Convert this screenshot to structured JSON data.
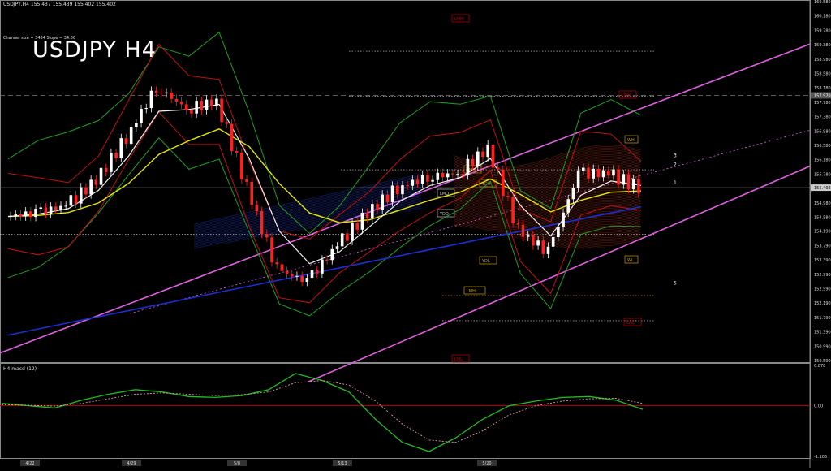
{
  "header": {
    "ohlc": "USDJPY,H4  155.437 155.439 155.402 155.402",
    "channel_info": "Channel size = 3484 Slope = 34.06",
    "title": "USDJPY H4",
    "macd_label": "H4  macd (12)"
  },
  "colors": {
    "background": "#000000",
    "bull_candle": "#ffffff",
    "bear_candle": "#ff2020",
    "channel": "#e060e0",
    "ema_slow": "#1a2fd6",
    "ema_mid": "#e6e600",
    "ema_fast": "#f0f0f0",
    "green_band": "#1fa01f",
    "red_band": "#c01010",
    "macd_main": "#20c020",
    "macd_signal": "#e0a0a0",
    "macd_zero": "#c00000"
  },
  "chart_data": [
    {
      "type": "line",
      "title": "USDJPY H4",
      "series": [
        {
          "name": "",
          "x": [
            "4/22",
            "4/23",
            "4/24",
            "4/25",
            "4/26",
            "4/29",
            "4/30",
            "5/1",
            "5/2",
            "5/3",
            "5/6",
            "5/7",
            "5/8",
            "5/9",
            "5/10",
            "5/13",
            "5/14",
            "5/15",
            "5/16",
            "5/17",
            "5/20",
            "5/21"
          ],
          "values": [
            154.6,
            154.7,
            154.9,
            155.6,
            156.8,
            158.2,
            157.6,
            157.8,
            155.4,
            153.1,
            152.8,
            153.8,
            154.7,
            155.4,
            155.7,
            155.8,
            156.5,
            154.2,
            153.6,
            155.8,
            155.8,
            155.4
          ]
        }
      ],
      "y_ticks": [
        "160.580",
        "160.180",
        "159.780",
        "159.380",
        "158.980",
        "158.580",
        "158.180",
        "157.780",
        "157.380",
        "156.980",
        "156.580",
        "156.180",
        "155.780",
        "155.402",
        "154.980",
        "154.580",
        "154.190",
        "153.790",
        "153.390",
        "152.990",
        "152.590",
        "152.190",
        "151.790",
        "151.390",
        "150.990",
        "150.590"
      ],
      "price_label": "155.402",
      "dashed_level_label": "157.970",
      "x_ticks": [
        "4/22",
        "4/29",
        "5/8",
        "5/13",
        "5/20"
      ],
      "ylim": [
        150.59,
        160.58
      ],
      "levels": [
        "LMH",
        "LWH",
        "LWL",
        "YDH",
        "YDL",
        "YDO",
        "LMO",
        "WH",
        "WL",
        "LMHL",
        "LMI",
        "1",
        "2",
        "3",
        "5"
      ],
      "grid": false
    },
    {
      "type": "line",
      "title": "H4  macd (12)",
      "y_ticks": [
        "0.878",
        "0.00",
        "-1.106"
      ],
      "ylim": [
        -1.106,
        0.878
      ],
      "series": [
        {
          "name": "",
          "values": [
            0.05,
            0.0,
            -0.05,
            0.12,
            0.25,
            0.35,
            0.3,
            0.2,
            0.18,
            0.22,
            0.35,
            0.7,
            0.55,
            0.3,
            -0.3,
            -0.8,
            -1.0,
            -0.7,
            -0.3,
            0.0,
            0.1,
            0.18,
            0.2,
            0.12,
            -0.08
          ]
        },
        {
          "name": "",
          "values": [
            0.02,
            0.01,
            -0.01,
            0.05,
            0.15,
            0.25,
            0.28,
            0.25,
            0.22,
            0.24,
            0.3,
            0.5,
            0.55,
            0.45,
            0.1,
            -0.4,
            -0.75,
            -0.8,
            -0.55,
            -0.2,
            0.0,
            0.1,
            0.15,
            0.16,
            0.05
          ]
        }
      ]
    }
  ]
}
